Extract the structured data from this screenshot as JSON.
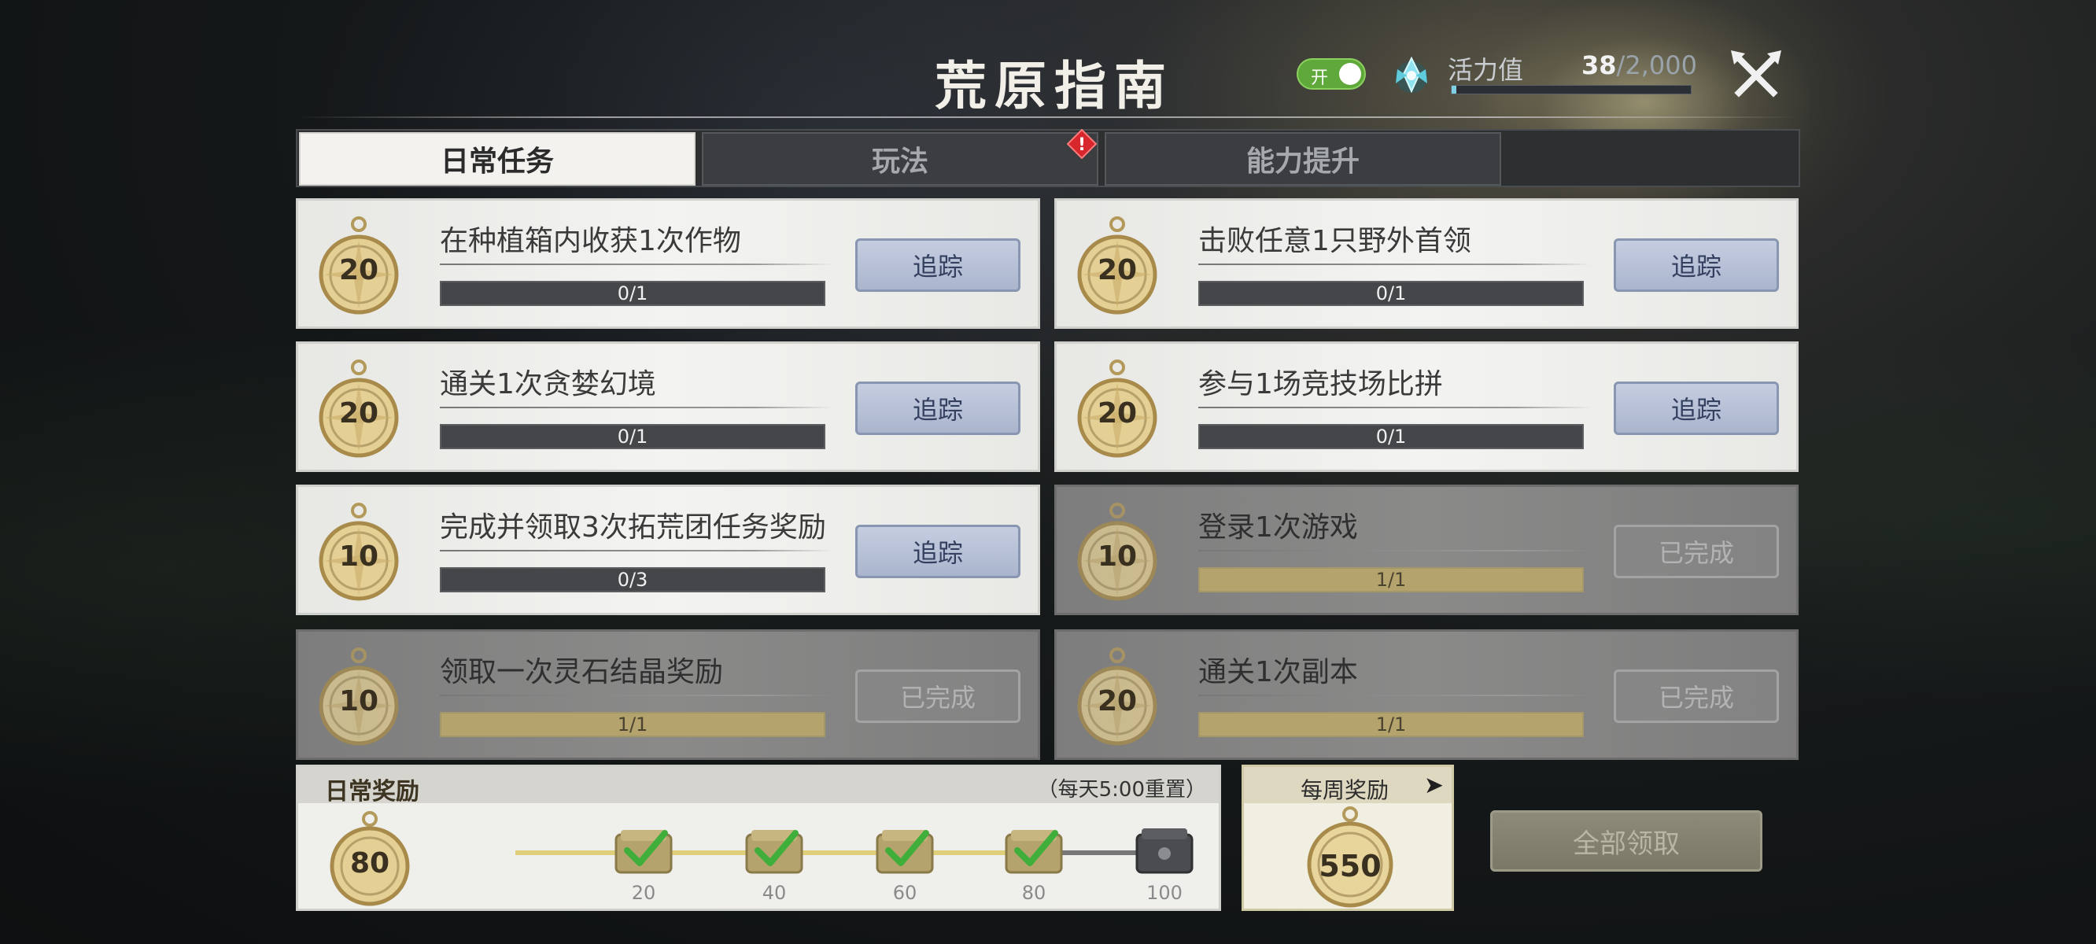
{
  "header": {
    "title": "荒原指南",
    "toggle_label": "开",
    "vitality_label": "活力值",
    "vitality_current": "38",
    "vitality_max": "/2,000",
    "vitality_fraction": 0.019
  },
  "tabs": [
    {
      "label": "日常任务",
      "active": true
    },
    {
      "label": "玩法",
      "active": false,
      "alert": "!"
    },
    {
      "label": "能力提升",
      "active": false
    }
  ],
  "tasks": [
    {
      "points": "20",
      "title": "在种植箱内收获1次作物",
      "progress_text": "0/1",
      "progress": 0,
      "button": "追踪",
      "completed": false
    },
    {
      "points": "20",
      "title": "击败任意1只野外首领",
      "progress_text": "0/1",
      "progress": 0,
      "button": "追踪",
      "completed": false
    },
    {
      "points": "20",
      "title": "通关1次贪婪幻境",
      "progress_text": "0/1",
      "progress": 0,
      "button": "追踪",
      "completed": false
    },
    {
      "points": "20",
      "title": "参与1场竞技场比拼",
      "progress_text": "0/1",
      "progress": 0,
      "button": "追踪",
      "completed": false
    },
    {
      "points": "10",
      "title": "完成并领取3次拓荒团任务奖励",
      "progress_text": "0/3",
      "progress": 0,
      "button": "追踪",
      "completed": false
    },
    {
      "points": "10",
      "title": "登录1次游戏",
      "progress_text": "1/1",
      "progress": 1,
      "button": "已完成",
      "completed": true
    },
    {
      "points": "10",
      "title": "领取一次灵石结晶奖励",
      "progress_text": "1/1",
      "progress": 1,
      "button": "已完成",
      "completed": true
    },
    {
      "points": "20",
      "title": "通关1次副本",
      "progress_text": "1/1",
      "progress": 1,
      "button": "已完成",
      "completed": true
    }
  ],
  "daily_reward": {
    "title": "日常奖励",
    "reset_note": "（每天5:00重置）",
    "points": "80",
    "progress_fraction": 0.8,
    "milestones": [
      {
        "label": "20",
        "claimed": true
      },
      {
        "label": "40",
        "claimed": true
      },
      {
        "label": "60",
        "claimed": true
      },
      {
        "label": "80",
        "claimed": true
      },
      {
        "label": "100",
        "claimed": false
      }
    ]
  },
  "weekly_reward": {
    "title": "每周奖励",
    "arrow": "➤",
    "points": "550"
  },
  "claim_all_label": "全部领取",
  "colors": {
    "track_button": "#aab5cd",
    "progress_done": "#b5a36d",
    "toggle_on": "#5fa83a",
    "check_green": "#3fae3a"
  }
}
